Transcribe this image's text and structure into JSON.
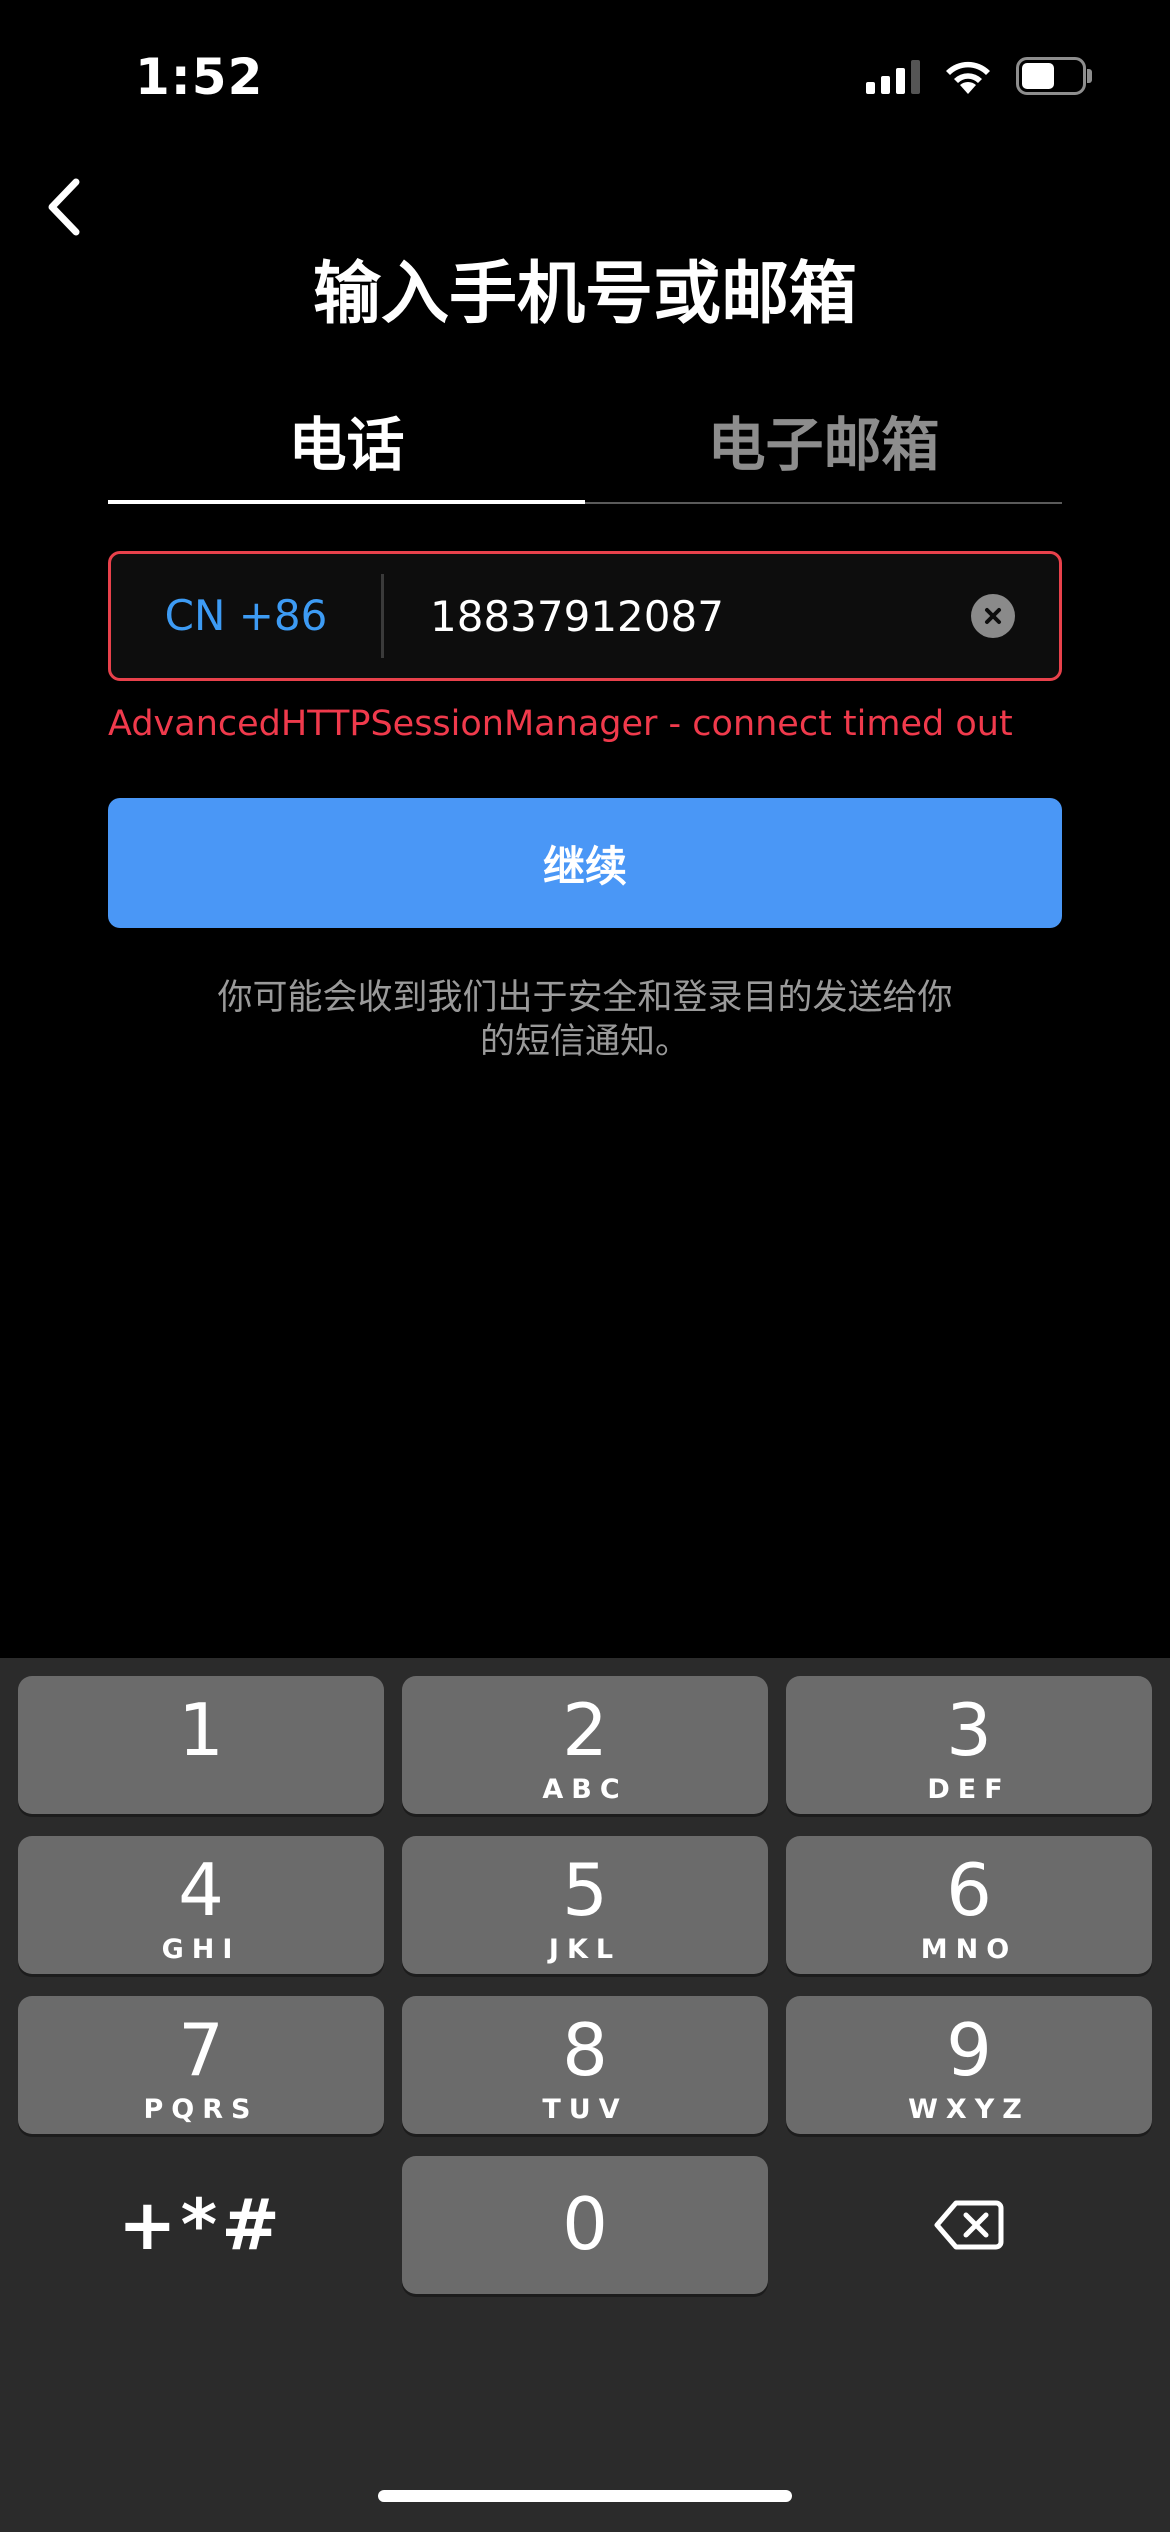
{
  "status_bar": {
    "time": "1:52"
  },
  "header": {
    "title": "输入手机号或邮箱"
  },
  "tabs": [
    {
      "label": "电话",
      "active": true
    },
    {
      "label": "电子邮箱",
      "active": false
    }
  ],
  "phone_field": {
    "country_code": "CN +86",
    "value": "18837912087"
  },
  "error_message": "AdvancedHTTPSessionManager - connect timed out",
  "continue_label": "继续",
  "notice_line1": "你可能会收到我们出于安全和登录目的发送给你",
  "notice_line2": "的短信通知。",
  "keypad": {
    "keys": [
      {
        "num": "1",
        "letters": ""
      },
      {
        "num": "2",
        "letters": "ABC"
      },
      {
        "num": "3",
        "letters": "DEF"
      },
      {
        "num": "4",
        "letters": "GHI"
      },
      {
        "num": "5",
        "letters": "JKL"
      },
      {
        "num": "6",
        "letters": "MNO"
      },
      {
        "num": "7",
        "letters": "PQRS"
      },
      {
        "num": "8",
        "letters": "TUV"
      },
      {
        "num": "9",
        "letters": "WXYZ"
      },
      {
        "num": "0",
        "letters": ""
      }
    ],
    "symbols_label": "+*#"
  },
  "colors": {
    "accent_blue": "#4a97f6",
    "country_blue": "#3d9bf4",
    "error_red": "#f03a4c",
    "keypad_bg": "#2b2b2b",
    "key_bg": "#6b6b6b"
  }
}
